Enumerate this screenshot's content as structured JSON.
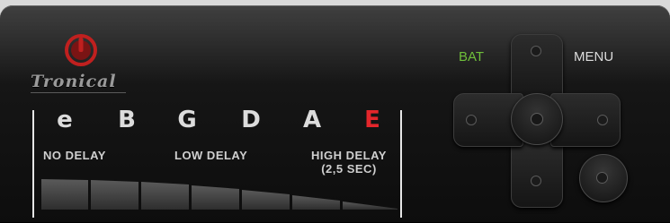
{
  "brand": {
    "name": "Tronical",
    "logo_icon": "power-icon",
    "logo_color": "#c0201f"
  },
  "strings": {
    "items": [
      {
        "label": "e",
        "active": false
      },
      {
        "label": "B",
        "active": false
      },
      {
        "label": "G",
        "active": false
      },
      {
        "label": "D",
        "active": false
      },
      {
        "label": "A",
        "active": false
      },
      {
        "label": "E",
        "active": true
      }
    ],
    "active_color": "#e3262b",
    "inactive_color": "#dcdcdc"
  },
  "delay": {
    "no_delay": "NO DELAY",
    "low_delay": "LOW DELAY",
    "high_delay_line1": "HIGH DELAY",
    "high_delay_line2": "(2,5 SEC)"
  },
  "controls": {
    "bat_label": "BAT",
    "bat_color": "#6fbf3a",
    "menu_label": "MENU",
    "dpad_icon": "dpad-icon",
    "round_button_icon": "circle-button-icon"
  }
}
